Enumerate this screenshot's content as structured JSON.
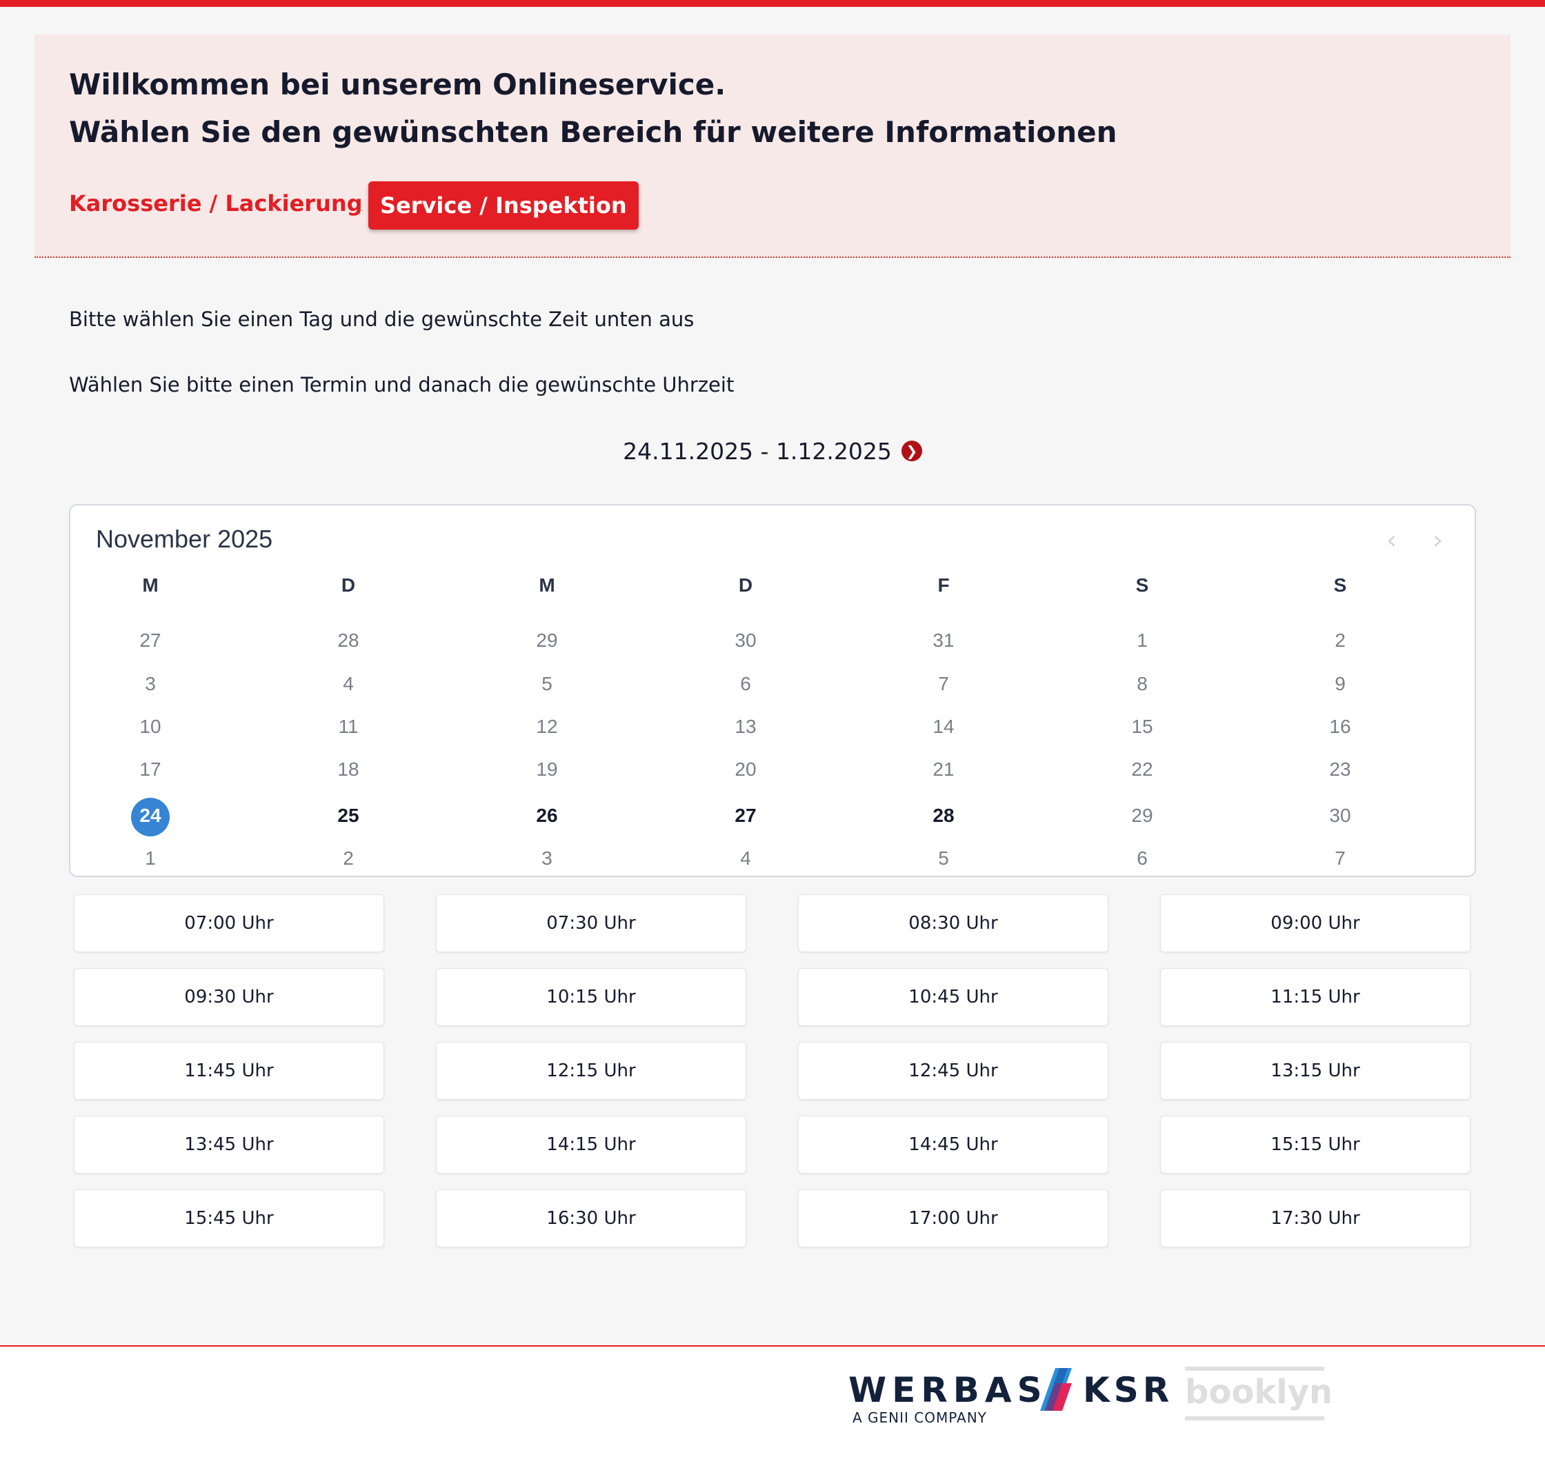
{
  "header": {
    "title_line1": "Willkommen bei unserem Onlineservice.",
    "title_line2": "Wählen Sie den gewünschten Bereich für weitere Informationen",
    "categories": [
      {
        "label": "Karosserie / Lackierung",
        "active": false
      },
      {
        "label": "Service / Inspektion",
        "active": true
      }
    ]
  },
  "instructions": {
    "line1": "Bitte wählen Sie einen Tag und die gewünschte Zeit unten aus",
    "line2": "Wählen Sie bitte einen Termin und danach die gewünschte Uhrzeit"
  },
  "range": {
    "label": "24.11.2025 - 1.12.2025",
    "next_icon": "chevron-circle-right-icon"
  },
  "calendar": {
    "title": "November 2025",
    "prev_icon": "chevron-left-icon",
    "next_icon": "chevron-right-icon",
    "weekdays": [
      "M",
      "D",
      "M",
      "D",
      "F",
      "S",
      "S"
    ],
    "weeks": [
      [
        "27",
        "28",
        "29",
        "30",
        "31",
        "1",
        "2"
      ],
      [
        "3",
        "4",
        "5",
        "6",
        "7",
        "8",
        "9"
      ],
      [
        "10",
        "11",
        "12",
        "13",
        "14",
        "15",
        "16"
      ],
      [
        "17",
        "18",
        "19",
        "20",
        "21",
        "22",
        "23"
      ],
      [
        "24",
        "25",
        "26",
        "27",
        "28",
        "29",
        "30"
      ],
      [
        "1",
        "2",
        "3",
        "4",
        "5",
        "6",
        "7"
      ]
    ],
    "selected_day": "24",
    "available_days": [
      "25",
      "26",
      "27",
      "28"
    ],
    "selected_color": "#3585d4"
  },
  "time_slots": [
    "07:00 Uhr",
    "07:30 Uhr",
    "08:30 Uhr",
    "09:00 Uhr",
    "09:30 Uhr",
    "10:15 Uhr",
    "10:45 Uhr",
    "11:15 Uhr",
    "11:45 Uhr",
    "12:15 Uhr",
    "12:45 Uhr",
    "13:15 Uhr",
    "13:45 Uhr",
    "14:15 Uhr",
    "14:45 Uhr",
    "15:15 Uhr",
    "15:45 Uhr",
    "16:30 Uhr",
    "17:00 Uhr",
    "17:30 Uhr"
  ],
  "footer": {
    "logo_werbas": "WERBAS",
    "logo_ksr": "KSR",
    "logo_sub": "A GENII COMPANY",
    "logo_booklyn": "booklyn"
  },
  "colors": {
    "accent": "#e31e24",
    "hero_bg": "#f7e9e8",
    "selected_day": "#3585d4"
  }
}
